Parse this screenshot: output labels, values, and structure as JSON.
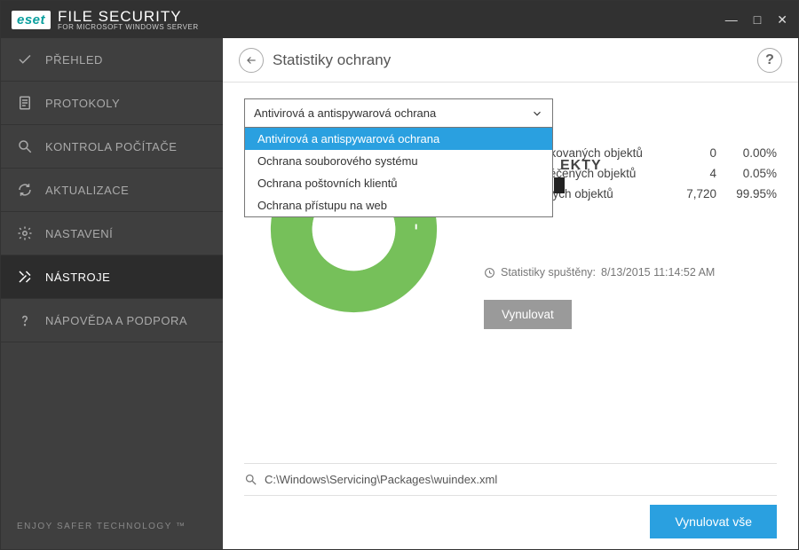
{
  "app": {
    "brand_short": "eset",
    "title": "FILE SECURITY",
    "subtitle": "FOR MICROSOFT WINDOWS SERVER"
  },
  "sidebar": {
    "items": [
      {
        "label": "PŘEHLED"
      },
      {
        "label": "PROTOKOLY"
      },
      {
        "label": "KONTROLA POČÍTAČE"
      },
      {
        "label": "AKTUALIZACE"
      },
      {
        "label": "NASTAVENÍ"
      },
      {
        "label": "NÁSTROJE"
      },
      {
        "label": "NÁPOVĚDA A PODPORA"
      }
    ],
    "footer": "ENJOY SAFER TECHNOLOGY ™"
  },
  "page": {
    "title": "Statistiky ochrany",
    "help_glyph": "?"
  },
  "dropdown": {
    "selected": "Antivirová a antispywarová ochrana",
    "options": [
      "Antivirová a antispywarová ochrana",
      "Ochrana souborového systému",
      "Ochrana poštovních klientů",
      "Ochrana přístupu na web"
    ]
  },
  "stats": {
    "section_title": "ZKONTROLOVANÉ OBJEKTY",
    "section_title_visible_fragment": "EKTY",
    "rows": [
      {
        "label": "Počet infikovaných objektů",
        "count": "0",
        "pct": "0.00%",
        "color": "#e24747"
      },
      {
        "label": "Počet vyléčených objektů",
        "count": "4",
        "pct": "0.05%",
        "color": "#e6c636"
      },
      {
        "label": "Počet čistých objektů",
        "count": "7,720",
        "pct": "99.95%",
        "color": "#76c05a"
      }
    ],
    "started_label": "Statistiky spuštěny:",
    "started_value": "8/13/2015 11:14:52 AM",
    "reset_label": "Vynulovat"
  },
  "chart_data": {
    "type": "pie",
    "title": "ZKONTROLOVANÉ OBJEKTY",
    "categories": [
      "Počet infikovaných objektů",
      "Počet vyléčených objektů",
      "Počet čistých objektů"
    ],
    "values": [
      0,
      4,
      7720
    ],
    "percentages": [
      0.0,
      0.05,
      99.95
    ],
    "colors": [
      "#e24747",
      "#e6c636",
      "#76c05a"
    ],
    "donut_inner_radius_pct": 58
  },
  "path_bar": {
    "value": "C:\\Windows\\Servicing\\Packages\\wuindex.xml"
  },
  "footer": {
    "reset_all_label": "Vynulovat vše"
  }
}
